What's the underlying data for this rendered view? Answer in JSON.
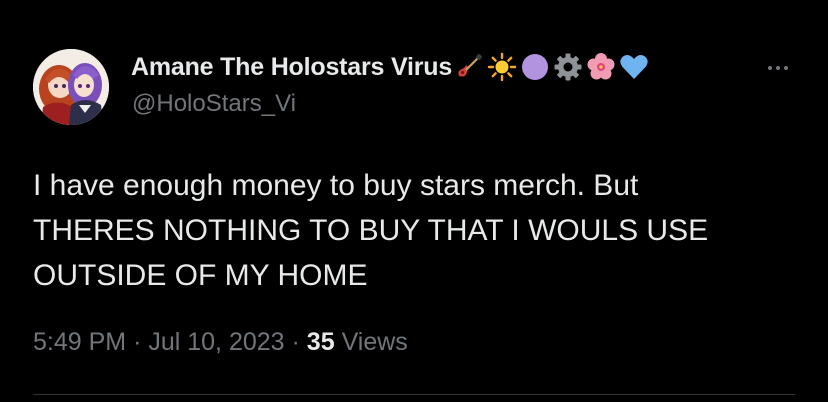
{
  "user": {
    "display_name": "Amane The Holostars Virus",
    "handle": "@HoloStars_Vi",
    "avatar_icon": "anime-characters-avatar",
    "name_emojis": [
      "guitar-icon",
      "sun-icon",
      "purple-circle-icon",
      "gear-icon",
      "hibiscus-icon",
      "blue-heart-icon"
    ]
  },
  "tweet": {
    "text_lines": [
      "I have enough money to buy stars merch. But",
      "THERES NOTHING TO BUY THAT I WOULS USE",
      "OUTSIDE OF MY HOME"
    ],
    "time": "5:49 PM",
    "separator": "·",
    "date": "Jul 10, 2023",
    "views_count": "35",
    "views_label": "Views"
  },
  "colors": {
    "background": "#000000",
    "primary_text": "#e7e9ea",
    "secondary_text": "#71767b",
    "divider": "#2f3336"
  }
}
